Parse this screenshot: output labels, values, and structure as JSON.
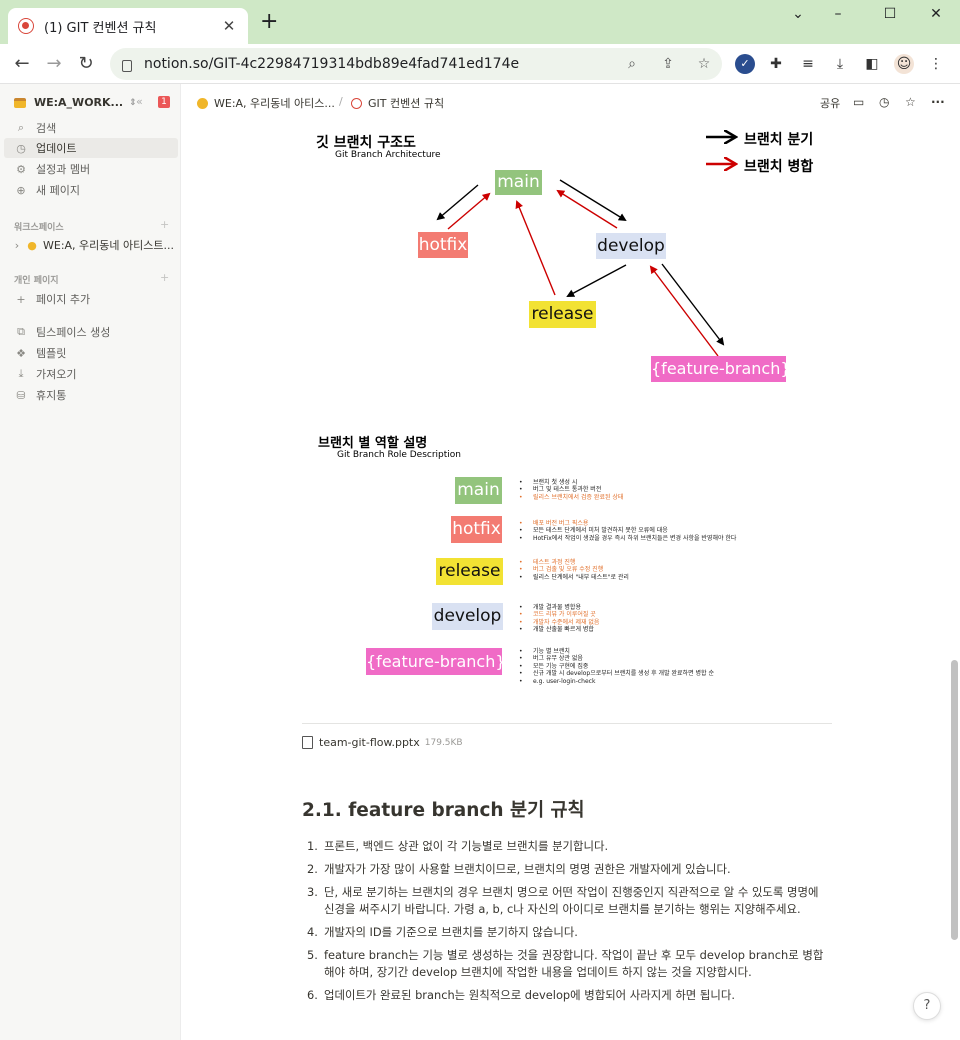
{
  "browser": {
    "tab_title": "(1) GIT 컨벤션 규칙",
    "tab_close": "✕",
    "new_tab": "+",
    "url": "notion.so/GIT-4c22984719314bdb89e4fad741ed174e",
    "window_controls": [
      "⌄",
      "–",
      "☐",
      "✕"
    ]
  },
  "sidebar": {
    "workspace": "WE:A_WORK...",
    "badge": "1",
    "top_items": [
      {
        "icon": "search-icon",
        "label": "검색"
      },
      {
        "icon": "clock-icon",
        "label": "업데이트"
      },
      {
        "icon": "gear-icon",
        "label": "설정과 멤버"
      },
      {
        "icon": "plus-circle-icon",
        "label": "새 페이지"
      }
    ],
    "section_workspace": "워크스페이스",
    "workspace_page": "WE:A, 우리동네 아티스트...",
    "section_private": "개인 페이지",
    "add_page": "페이지 추가",
    "bottom_items": [
      {
        "icon": "teamspace-icon",
        "label": "팀스페이스 생성"
      },
      {
        "icon": "template-icon",
        "label": "템플릿"
      },
      {
        "icon": "import-icon",
        "label": "가져오기"
      },
      {
        "icon": "trash-icon",
        "label": "휴지통"
      }
    ]
  },
  "topbar": {
    "breadcrumb_parent": "WE:A, 우리동네 아티스...",
    "breadcrumb_sep": "/",
    "breadcrumb_current": "GIT 컨벤션 규칙",
    "share": "공유"
  },
  "diagram1": {
    "title": "깃 브랜치 구조도",
    "subtitle": "Git Branch Architecture",
    "legend_branch": "브랜치 분기",
    "legend_merge": "브랜치 병합",
    "nodes": {
      "main": "main",
      "hotfix": "hotfix",
      "develop": "develop",
      "release": "release",
      "feature": "{feature-branch}"
    },
    "colors": {
      "main": "#93c47d",
      "hotfix": "#f37b72",
      "develop": "#d9e1f2",
      "release": "#f2e233",
      "feature": "#f06bc6",
      "branch_arrow": "#000000",
      "merge_arrow": "#cc0000"
    }
  },
  "diagram2": {
    "title": "브랜치 별 역할 설명",
    "subtitle": "Git Branch Role Description",
    "roles": [
      {
        "name": "main",
        "lines": [
          {
            "text": "브랜치 첫 생성 시",
            "hl": false
          },
          {
            "text": "버그 및 테스트 통과한 버전",
            "hl": false
          },
          {
            "text": "릴리스 브랜치에서 검증 완료된 상태",
            "hl": true
          }
        ]
      },
      {
        "name": "hotfix",
        "lines": [
          {
            "text": "배포 버전 버그 픽스용",
            "hl": true
          },
          {
            "text": "모든 테스트 단계에서 미처 발견하지 못한 오류에 대응",
            "hl": false
          },
          {
            "text": "HotFix에서 작업이 생겼을 경우 즉시 하위 브랜치들은 변경 사항을 반영해야 한다",
            "hl": false
          }
        ]
      },
      {
        "name": "release",
        "lines": [
          {
            "text": "테스트 과정 진행",
            "hl": true
          },
          {
            "text": "버그 검출 및 오류 수정 진행",
            "hl": true
          },
          {
            "text": "릴리스 단계에서 \"내부 테스트\"로 관리",
            "hl": false
          }
        ]
      },
      {
        "name": "develop",
        "lines": [
          {
            "text": "개발 결과물 병합용",
            "hl": false
          },
          {
            "text": "코드 리뷰 가 이루어질 곳",
            "hl": true
          },
          {
            "text": "개발자 수준에서 제재 없음",
            "hl": true
          },
          {
            "text": "개발 산출물 빠르게 병합",
            "hl": false
          }
        ]
      },
      {
        "name": "{feature-branch}",
        "lines": [
          {
            "text": "기능 별 브랜치",
            "hl": false
          },
          {
            "text": "버그 유무 상관 없음",
            "hl": false
          },
          {
            "text": "모든 기능 구현에 집중",
            "hl": false
          },
          {
            "text": "신규 개발 시 develop으로부터 브랜치를 생성 후 개발 완료하면 병합 순",
            "hl": false
          },
          {
            "text": "e.g. user-login-check",
            "hl": false
          }
        ]
      }
    ]
  },
  "attachment": {
    "filename": "team-git-flow.pptx",
    "size": "179.5KB"
  },
  "section": {
    "heading": "2.1. feature branch 분기 규칙",
    "items": [
      {
        "num": "1.",
        "text": "프론트, 백엔드 상관 없이 각 기능별로 브랜치를 분기합니다."
      },
      {
        "num": "2.",
        "text": "개발자가 가장 많이 사용할 브랜치이므로, 브랜치의 명명 권한은 개발자에게 있습니다."
      },
      {
        "num": "3.",
        "text": "단, 새로 분기하는 브랜치의 경우 브랜치 명으로 어떤 작업이 진행중인지 직관적으로 알 수 있도록 명명에 신경을 써주시기 바랍니다. 가령 a, b, c나 자신의 아이디로 브랜치를 분기하는 행위는 지양해주세요."
      },
      {
        "num": "4.",
        "text": "개발자의 ID를 기준으로 브랜치를 분기하지 않습니다."
      },
      {
        "num": "5.",
        "text": "feature branch는 기능 별로 생성하는 것을 권장합니다. 작업이 끝난 후 모두 develop branch로 병합해야 하며, 장기간 develop 브랜치에 작업한 내용을 업데이트 하지 않는 것을 지양합시다."
      },
      {
        "num": "6.",
        "text": "업데이트가 완료된 branch는 원칙적으로 develop에 병합되어 사라지게 하면 됩니다."
      }
    ]
  },
  "help": "?"
}
